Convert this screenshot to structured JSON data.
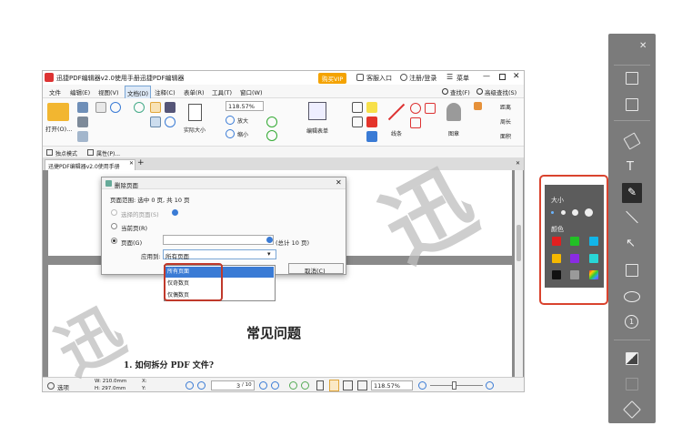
{
  "app": {
    "title": "迅捷PDF编辑器v2.0使用手册迅捷PDF编辑器",
    "vip": "购买VIP",
    "service": "客服入口",
    "login": "注册/登录",
    "menu_label": "菜单"
  },
  "menubar": {
    "items": [
      "文件",
      "编辑(E)",
      "视图(V)",
      "文档(D)",
      "注释(C)",
      "表单(R)",
      "工具(T)",
      "窗口(W)"
    ],
    "search": "查找(F)",
    "advanced_search": "高级查找(S)"
  },
  "ribbon": {
    "open": "打开(O)...",
    "zoom": "118.57%",
    "actual_size": "实际大小",
    "zoom_in": "放大",
    "zoom_out": "缩小",
    "edit_form": "编辑表单",
    "line": "线条",
    "stamp": "图章",
    "distance": "距离",
    "perimeter": "周长",
    "area": "面积"
  },
  "subbar": {
    "click_mode": "独点模式",
    "properties": "属性(P)..."
  },
  "tab": {
    "label": "迅捷PDF编辑器v2.0使用手册"
  },
  "dialog": {
    "title": "删除页面",
    "range": "页面范围: 选中 0 页, 共 10 页",
    "opt_selected": "选择的页面(S)",
    "opt_current": "当前页(R)",
    "opt_pages": "页面(G)",
    "total": "(总计 10 页)",
    "apply_to": "应用到:",
    "apply_value": "所有页面",
    "cancel": "取消(C)",
    "options": [
      "所有页面",
      "仅奇数页",
      "仅偶数页"
    ]
  },
  "document": {
    "heading": "常见问题",
    "question": "1.  如何拆分 PDF 文件?"
  },
  "statusbar": {
    "options": "选项",
    "width": "W: 210.0mm",
    "height": "H: 297.0mm",
    "x": "X:",
    "y": "Y:",
    "page": "3",
    "total": "/ 10",
    "zoom": "118.57%"
  },
  "color_panel": {
    "size_label": "大小",
    "color_label": "颜色",
    "swatches": [
      "#e02020",
      "#22c025",
      "#12b5e8",
      "#f5b800",
      "#8a2be2",
      "#29d6d6",
      "#111111",
      "#9a9a9a",
      "#ffffff"
    ]
  },
  "watermark": {
    "right": "迅",
    "left": "迅"
  }
}
